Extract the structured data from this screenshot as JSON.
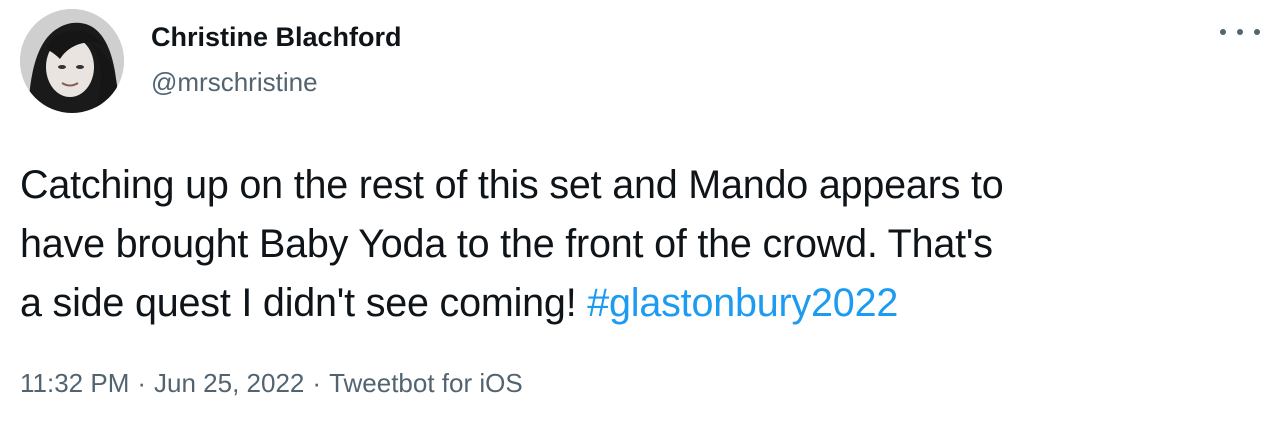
{
  "author": {
    "display_name": "Christine Blachford",
    "handle": "@mrschristine",
    "avatar_icon": "profile-photo"
  },
  "more_menu_icon": "more-horizontal-icon",
  "tweet": {
    "line1": "Catching up on the rest of this set and Mando appears to",
    "line2": "have brought Baby Yoda to the front of the crowd. That's",
    "line3_text": "a side quest I didn't see coming! ",
    "hashtag": "#glastonbury2022"
  },
  "meta": {
    "time": "11:32 PM",
    "separator": "·",
    "date": "Jun 25, 2022",
    "source": "Tweetbot for iOS"
  },
  "colors": {
    "hashtag": "#1d9bf0",
    "secondary_text": "#536471",
    "primary_text": "#0f1419"
  }
}
